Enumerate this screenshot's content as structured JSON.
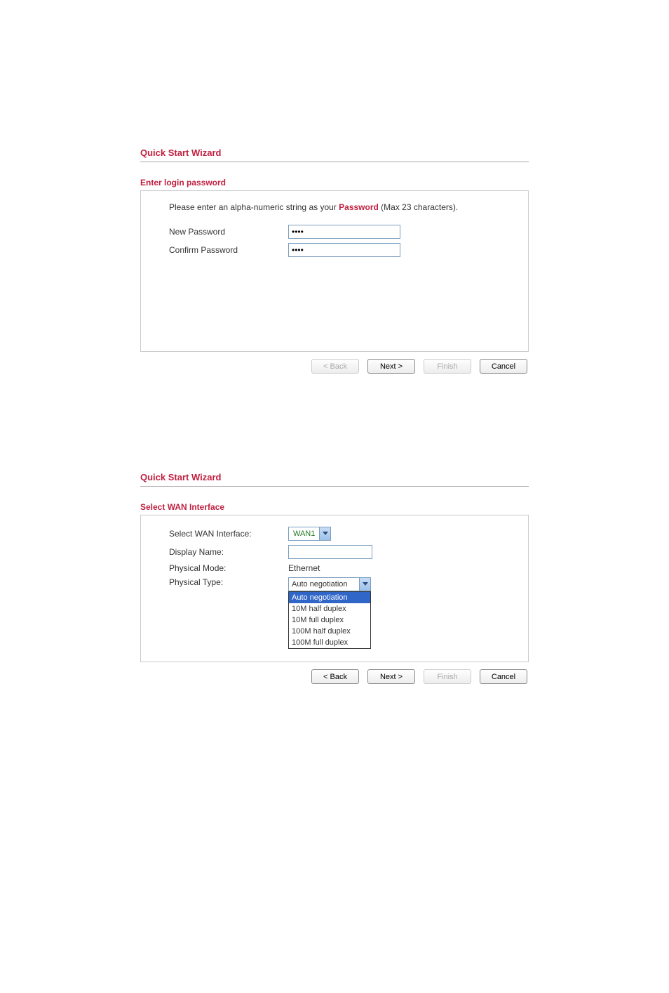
{
  "wizard1": {
    "title": "Quick Start Wizard",
    "step_title": "Enter login password",
    "instructions_pre": "Please enter an alpha-numeric string as your ",
    "instructions_bold": "Password",
    "instructions_post": " (Max 23 characters).",
    "new_password_label": "New Password",
    "confirm_password_label": "Confirm Password",
    "new_password_value": "••••",
    "confirm_password_value": "••••",
    "buttons": {
      "back": "< Back",
      "next": "Next >",
      "finish": "Finish",
      "cancel": "Cancel"
    }
  },
  "wizard2": {
    "title": "Quick Start Wizard",
    "step_title": "Select WAN Interface",
    "select_wan_label": "Select WAN Interface:",
    "select_wan_value": "WAN1",
    "display_name_label": "Display Name:",
    "display_name_value": "",
    "physical_mode_label": "Physical Mode:",
    "physical_mode_value": "Ethernet",
    "physical_type_label": "Physical Type:",
    "physical_type_selected": "Auto negotiation",
    "physical_type_options": [
      "Auto negotiation",
      "10M half duplex",
      "10M full duplex",
      "100M half duplex",
      "100M full duplex"
    ],
    "buttons": {
      "back": "< Back",
      "next": "Next >",
      "finish": "Finish",
      "cancel": "Cancel"
    }
  }
}
